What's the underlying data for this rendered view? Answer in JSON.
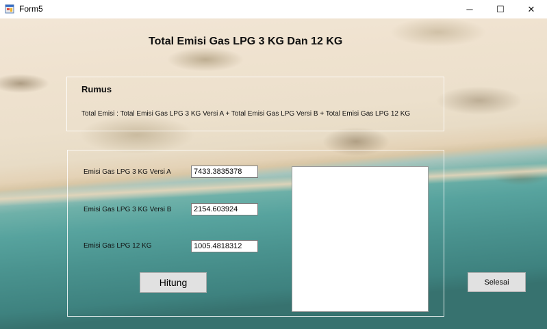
{
  "window": {
    "title": "Form5",
    "icon": "form-app-icon",
    "controls": {
      "minimize": "─",
      "maximize": "☐",
      "close": "✕"
    }
  },
  "form": {
    "heading": "Total Emisi Gas LPG 3 KG Dan 12 KG",
    "rumus": {
      "title": "Rumus",
      "formula": "Total Emisi  :  Total Emisi Gas LPG 3 KG Versi A + Total Emisi Gas LPG Versi B + Total Emisi Gas LPG 12 KG"
    },
    "fields": [
      {
        "label": "Emisi Gas LPG 3 KG Versi A",
        "value": "7433.3835378"
      },
      {
        "label": "Emisi Gas LPG 3 KG Versi B",
        "value": "2154.603924"
      },
      {
        "label": "Emisi Gas LPG 12 KG",
        "value": "1005.4818312"
      }
    ],
    "result": "",
    "buttons": {
      "hitung": "Hitung",
      "selesai": "Selesai"
    }
  }
}
